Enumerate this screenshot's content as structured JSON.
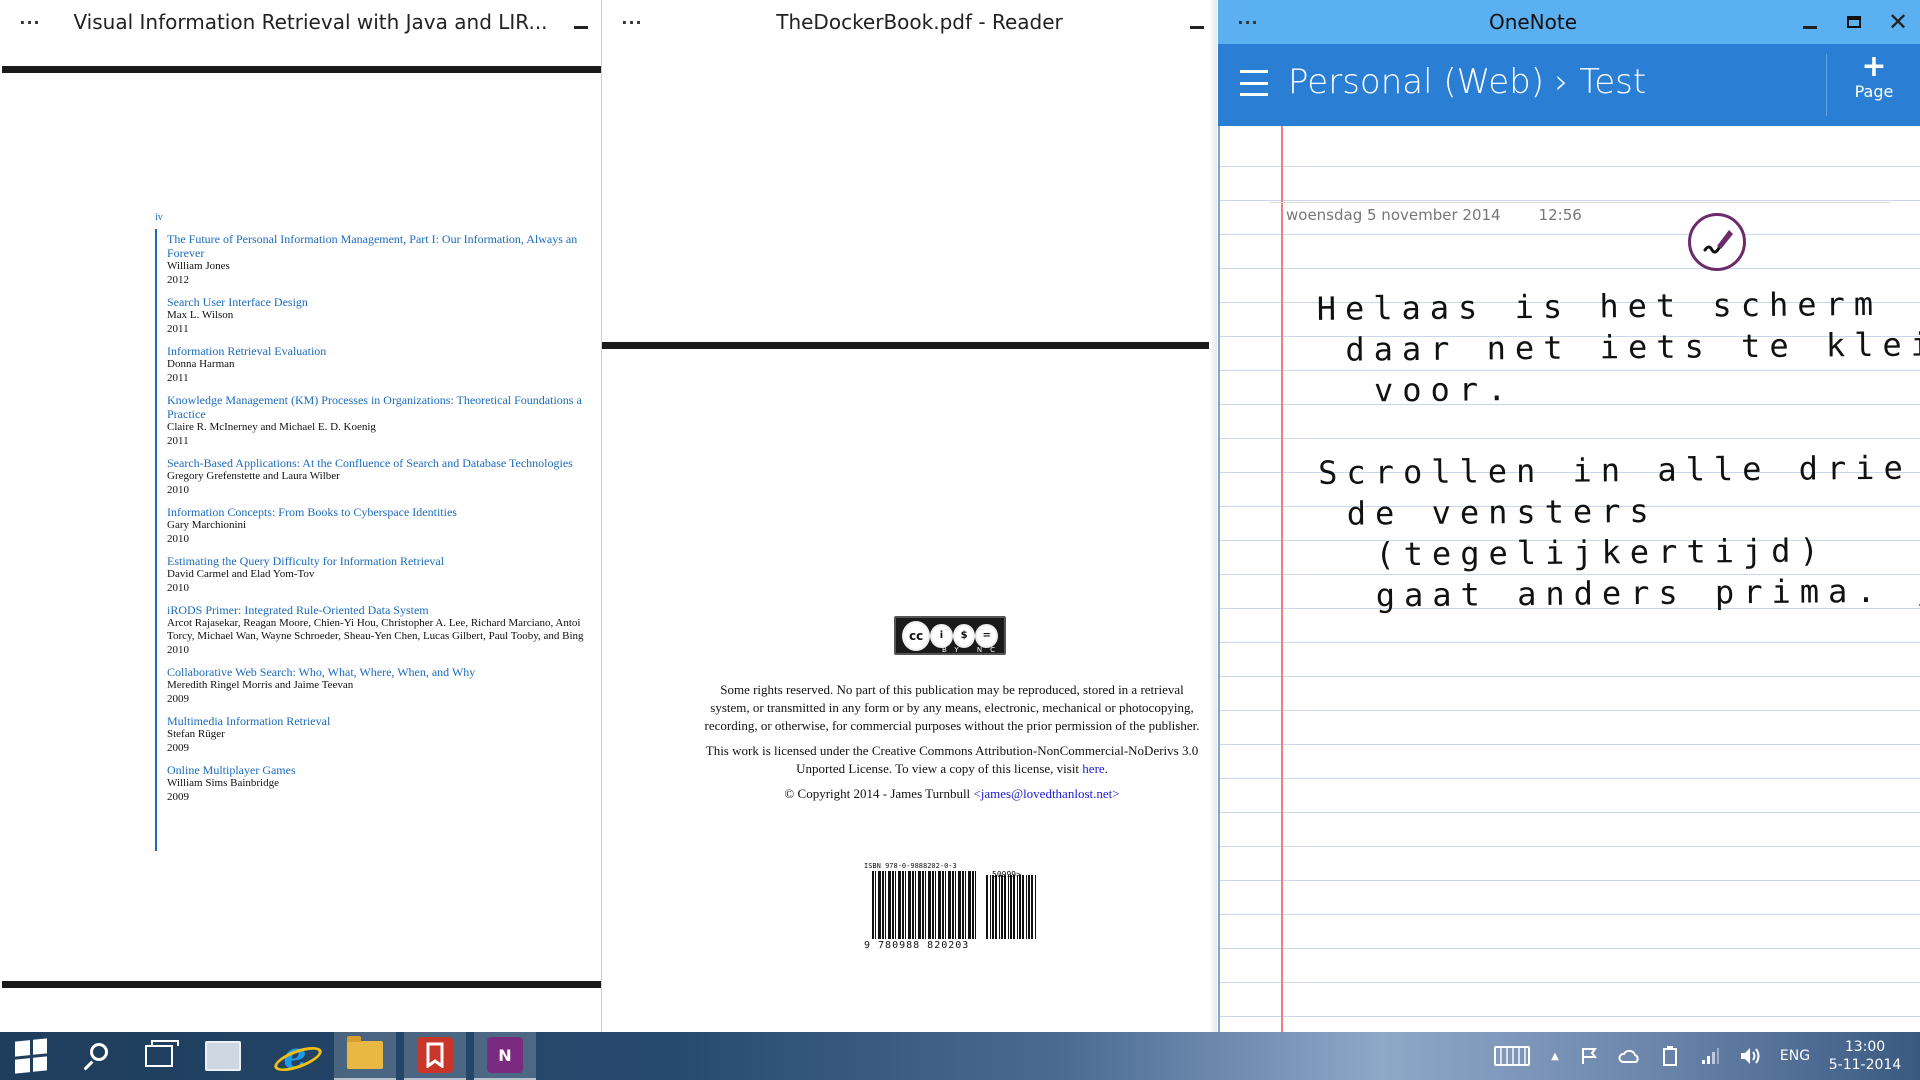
{
  "window1": {
    "menu_dots": "···",
    "title": "Visual Information Retrieval with Java and LIR...",
    "toc": {
      "page_numeral": "iv",
      "entries": [
        {
          "title": "The Future of Personal Information Management, Part I: Our Information, Always an\nForever",
          "authors": "William Jones",
          "year": "2012"
        },
        {
          "title": "Search User Interface Design",
          "authors": "Max L. Wilson",
          "year": "2011"
        },
        {
          "title": "Information Retrieval Evaluation",
          "authors": "Donna Harman",
          "year": "2011"
        },
        {
          "title": "Knowledge Management (KM) Processes in Organizations: Theoretical Foundations a\nPractice",
          "authors": "Claire R. McInerney and Michael E. D. Koenig",
          "year": "2011"
        },
        {
          "title": "Search-Based Applications: At the Confluence of Search and Database Technologies",
          "authors": "Gregory Grefenstette and Laura Wilber",
          "year": "2010"
        },
        {
          "title": "Information Concepts: From Books to Cyberspace Identities",
          "authors": "Gary Marchionini",
          "year": "2010"
        },
        {
          "title": "Estimating the Query Difficulty for Information Retrieval",
          "authors": "David Carmel and Elad Yom-Tov",
          "year": "2010"
        },
        {
          "title": "iRODS Primer: Integrated Rule-Oriented Data System",
          "authors": "Arcot Rajasekar, Reagan Moore, Chien-Yi Hou, Christopher A. Lee, Richard Marciano, Antoi\nTorcy, Michael Wan, Wayne Schroeder, Sheau-Yen Chen, Lucas Gilbert, Paul Tooby, and Bing",
          "year": "2010"
        },
        {
          "title": "Collaborative Web Search: Who, What, Where, When, and Why",
          "authors": "Meredith Ringel Morris and Jaime Teevan",
          "year": "2009"
        },
        {
          "title": "Multimedia Information Retrieval",
          "authors": "Stefan Rüger",
          "year": "2009"
        },
        {
          "title": "Online Multiplayer Games",
          "authors": "William Sims Bainbridge",
          "year": "2009"
        }
      ]
    }
  },
  "window2": {
    "menu_dots": "···",
    "title": "TheDockerBook.pdf - Reader",
    "cc_badge": {
      "cc": "cc",
      "by": "i",
      "nc": "$",
      "nd": "=",
      "labels": "BY NC ND"
    },
    "legal_p1": "Some rights reserved. No part of this publication may be reproduced, stored in a retrieval system, or transmitted in any form or by any means, electronic, mechanical or photocopying, recording, or otherwise, for commercial purposes without the prior permission of the publisher.",
    "legal_p2": "This work is licensed under the Creative Commons Attribution-NonCommercial-NoDerivs 3.0 Unported License. To view a copy of this license, visit",
    "legal_p2_link": "here",
    "legal_p2_end": ".",
    "copyright": "© Copyright 2014 - James Turnbull",
    "email": "<james@lovedthanlost.net>",
    "barcode": {
      "isbn": "ISBN 978-0-9888202-0-3",
      "number": "9 780988 820203",
      "addon": "50999>"
    }
  },
  "window3": {
    "menu_dots": "···",
    "title": "OneNote",
    "breadcrumb": "Personal (Web) › Test",
    "add_page": {
      "plus": "+",
      "label": "Page"
    },
    "date": "woensdag 5 november 2014",
    "time": "12:56",
    "note_lines": [
      "Helaas is het scherm",
      " daar net iets te klein",
      "  voor.",
      "",
      "Scrollen in alle drie",
      " de vensters",
      "  (tegelijkertijd)",
      "  gaat anders prima. ;)"
    ]
  },
  "taskbar": {
    "lang": "ENG",
    "time": "13:00",
    "date": "5-11-2014",
    "tray_up": "▲"
  },
  "colors": {
    "onenote_header": "#2a7fd4",
    "onenote_titlebar": "#5ab0f0",
    "link_blue": "#1a6bbd",
    "onenote_purple": "#6b2c6b"
  }
}
